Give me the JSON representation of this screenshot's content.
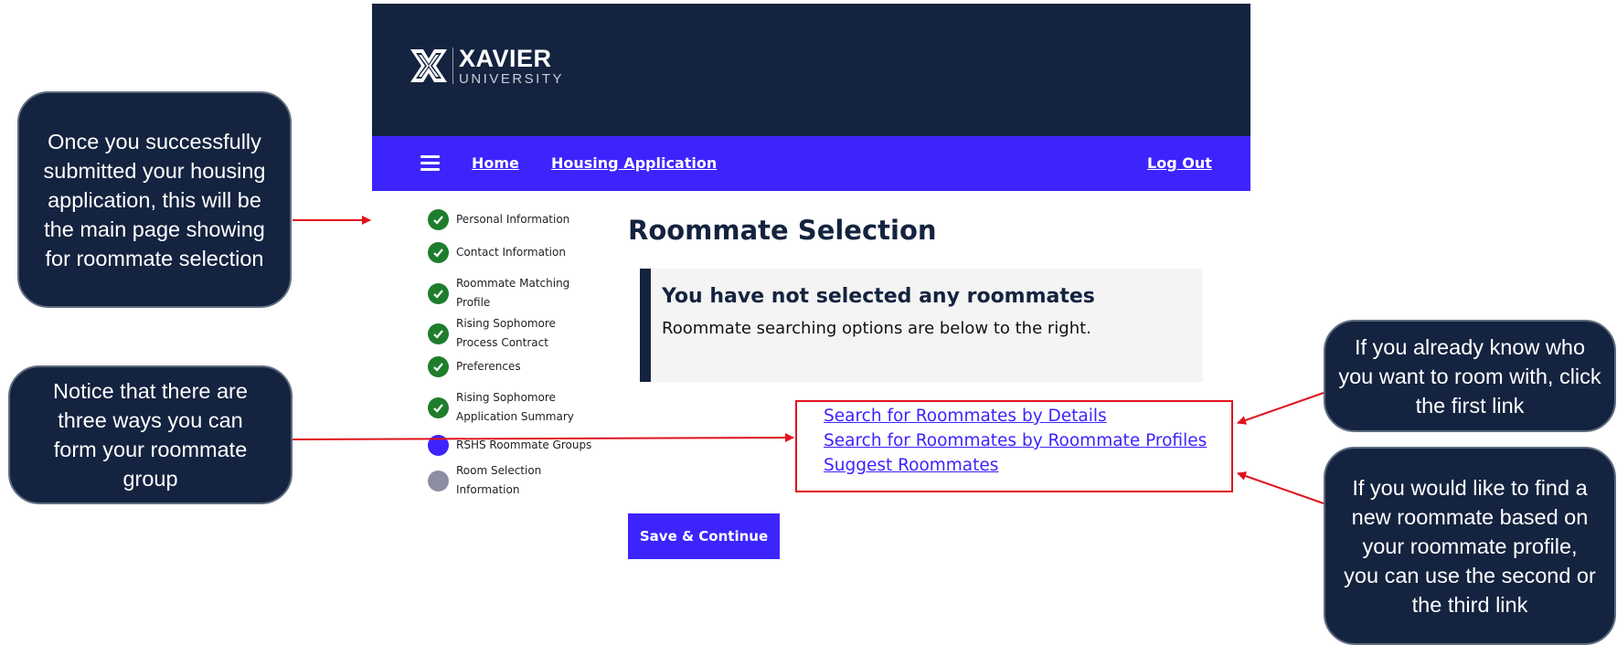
{
  "header": {
    "logo_name": "XAVIER",
    "logo_sub": "UNIVERSITY"
  },
  "navbar": {
    "menu_icon": "hamburger-menu-icon",
    "home": "Home",
    "housing_application": "Housing Application",
    "log_out": "Log Out"
  },
  "steps": [
    {
      "label": "Personal Information",
      "status": "complete"
    },
    {
      "label": "Contact Information",
      "status": "complete"
    },
    {
      "label": "Roommate Matching\nProfile",
      "status": "complete"
    },
    {
      "label": "Rising Sophomore\nProcess Contract",
      "status": "complete"
    },
    {
      "label": "Preferences",
      "status": "complete"
    },
    {
      "label": "Rising Sophomore\nApplication Summary",
      "status": "complete"
    },
    {
      "label": "RSHS Roommate Groups",
      "status": "current"
    },
    {
      "label": "Room Selection\nInformation",
      "status": "incomplete"
    }
  ],
  "main": {
    "title": "Roommate Selection",
    "notice_title": "You have not selected any roommates",
    "notice_text": "Roommate searching options are below to the right.",
    "links": [
      "Search for Roommates by Details",
      "Search for Roommates by Roommate Profiles",
      "Suggest Roommates"
    ],
    "save_button": "Save & Continue"
  },
  "callouts": {
    "main_page": "Once you successfully submitted your housing application, this will be the main page showing for roommate selection",
    "three_ways": "Notice that there are three ways you can form your roommate group",
    "first_link": "If you already know who you want to room with, click the first link",
    "second_third": "If you would like to find a new roommate based on your roommate profile, you can use the second or the third link"
  },
  "colors": {
    "navy": "#14233f",
    "accent": "#3d24fd",
    "success": "#1e7d2c",
    "highlight": "#e0131c"
  }
}
